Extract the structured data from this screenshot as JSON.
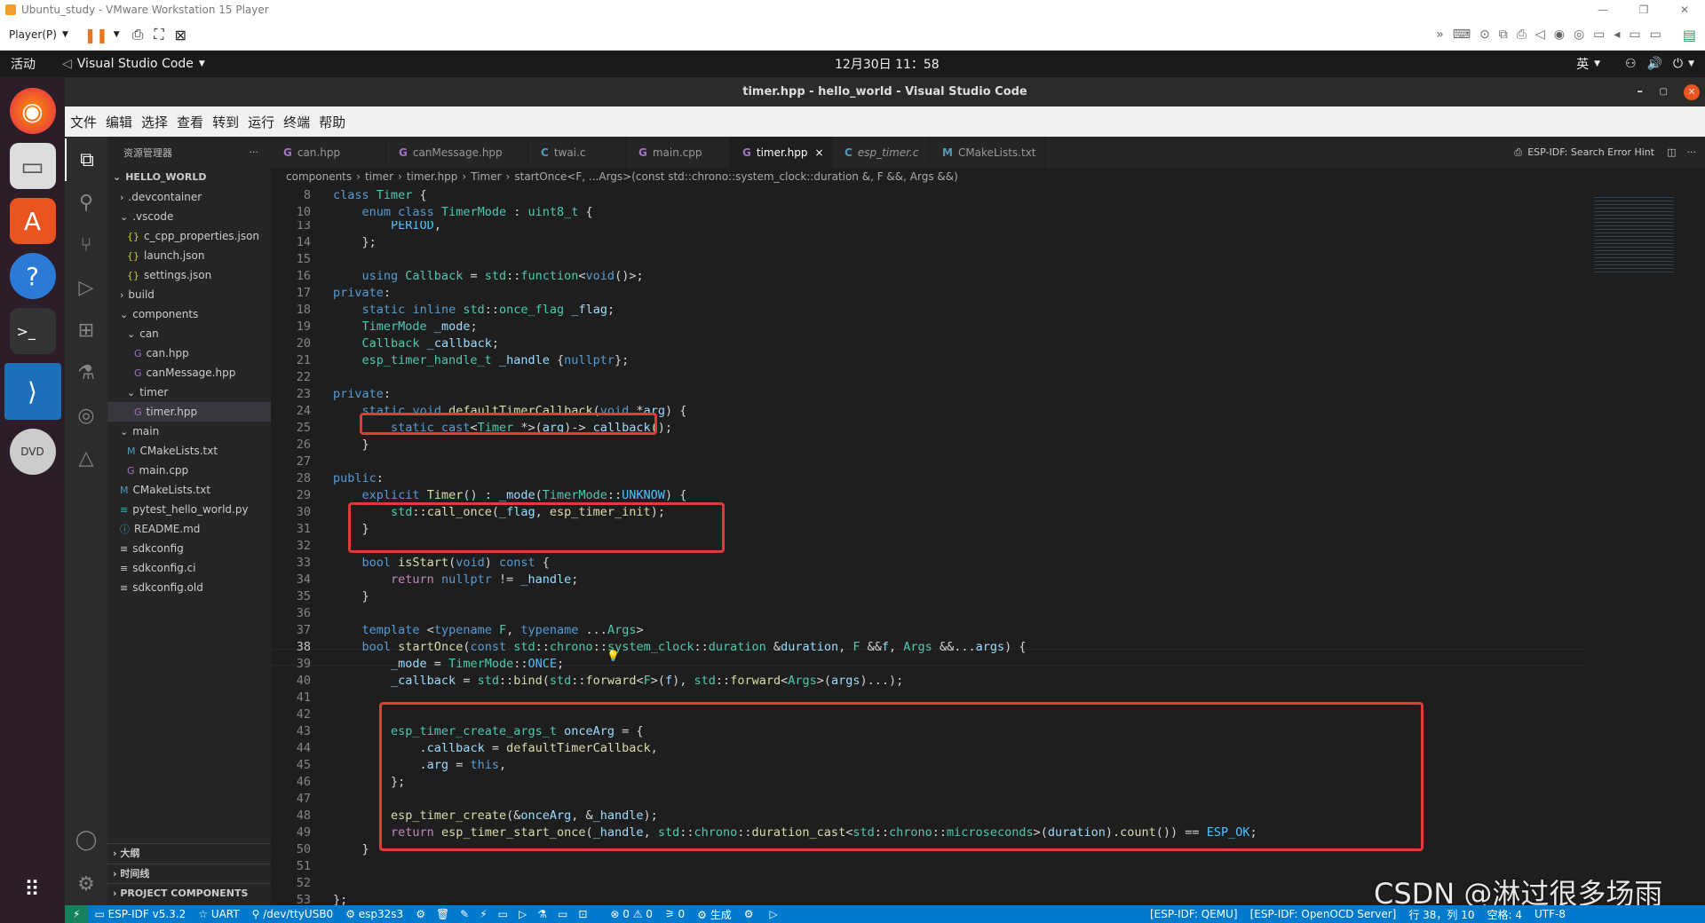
{
  "vm": {
    "title": "Ubuntu_study - VMware Workstation 15 Player",
    "player_menu": "Player(P)",
    "window_controls": [
      "minimize-icon",
      "restore-icon",
      "close-icon"
    ]
  },
  "gnome": {
    "activities": "活动",
    "app_name": "Visual Studio Code",
    "clock": "12月30日  11：58",
    "input_method": "英"
  },
  "vscode": {
    "window_title": "timer.hpp - hello_world - Visual Studio Code",
    "menu": [
      "文件",
      "编辑",
      "选择",
      "查看",
      "转到",
      "运行",
      "终端",
      "帮助"
    ],
    "explorer_title": "资源管理器",
    "explorer_more": "···",
    "tree": [
      {
        "label": "HELLO_WORLD",
        "depth": 0,
        "kind": "root"
      },
      {
        "label": ".devcontainer",
        "depth": 1,
        "kind": "folder-closed"
      },
      {
        "label": ".vscode",
        "depth": 1,
        "kind": "folder-open"
      },
      {
        "label": "c_cpp_properties.json",
        "depth": 2,
        "kind": "json"
      },
      {
        "label": "launch.json",
        "depth": 2,
        "kind": "json"
      },
      {
        "label": "settings.json",
        "depth": 2,
        "kind": "json"
      },
      {
        "label": "build",
        "depth": 1,
        "kind": "folder-closed"
      },
      {
        "label": "components",
        "depth": 1,
        "kind": "folder-open"
      },
      {
        "label": "can",
        "depth": 2,
        "kind": "folder-open"
      },
      {
        "label": "can.hpp",
        "depth": 3,
        "kind": "cpp"
      },
      {
        "label": "canMessage.hpp",
        "depth": 3,
        "kind": "cpp"
      },
      {
        "label": "timer",
        "depth": 2,
        "kind": "folder-open"
      },
      {
        "label": "timer.hpp",
        "depth": 3,
        "kind": "cpp",
        "selected": true
      },
      {
        "label": "main",
        "depth": 1,
        "kind": "folder-open"
      },
      {
        "label": "CMakeLists.txt",
        "depth": 2,
        "kind": "cmake"
      },
      {
        "label": "main.cpp",
        "depth": 2,
        "kind": "cpp"
      },
      {
        "label": "CMakeLists.txt",
        "depth": 1,
        "kind": "cmake"
      },
      {
        "label": "pytest_hello_world.py",
        "depth": 1,
        "kind": "py"
      },
      {
        "label": "README.md",
        "depth": 1,
        "kind": "md"
      },
      {
        "label": "sdkconfig",
        "depth": 1,
        "kind": "txt"
      },
      {
        "label": "sdkconfig.ci",
        "depth": 1,
        "kind": "txt"
      },
      {
        "label": "sdkconfig.old",
        "depth": 1,
        "kind": "txt"
      }
    ],
    "bottom_panels": [
      "大纲",
      "时间线",
      "PROJECT COMPONENTS"
    ],
    "tabs": [
      {
        "label": "can.hpp",
        "icon": "G"
      },
      {
        "label": "canMessage.hpp",
        "icon": "G"
      },
      {
        "label": "twai.c",
        "icon": "C"
      },
      {
        "label": "main.cpp",
        "icon": "G"
      },
      {
        "label": "timer.hpp",
        "icon": "G",
        "active": true,
        "close": "×"
      },
      {
        "label": "esp_timer.c",
        "icon": "C",
        "italic": true
      },
      {
        "label": "CMakeLists.txt",
        "icon": "M"
      }
    ],
    "tab_right": "ESP-IDF: Search Error Hint",
    "breadcrumb": [
      "components",
      "timer",
      "timer.hpp",
      "Timer",
      "startOnce<F, ...Args>(const std::chrono::system_clock::duration &, F &&, Args &&)"
    ],
    "code_lines": [
      {
        "n": "8",
        "html": "<span class='k'>class</span> <span class='t'>Timer</span> {"
      },
      {
        "n": "10",
        "html": "    <span class='k'>enum class</span> <span class='t'>TimerMode</span> : <span class='t'>uint8_t</span> {"
      },
      {
        "n": "13",
        "html": "        <span class='e'>PERIOD</span>,"
      },
      {
        "n": "14",
        "html": "    };"
      },
      {
        "n": "15",
        "html": ""
      },
      {
        "n": "16",
        "html": "    <span class='k'>using</span> <span class='t'>Callback</span> = <span class='t'>std</span>::<span class='t'>function</span>&lt;<span class='k'>void</span>()&gt;;"
      },
      {
        "n": "17",
        "html": "<span class='k'>private</span>:"
      },
      {
        "n": "18",
        "html": "    <span class='k'>static</span> <span class='k'>inline</span> <span class='t'>std</span>::<span class='t'>once_flag</span> <span class='v'>_flag</span>;"
      },
      {
        "n": "19",
        "html": "    <span class='t'>TimerMode</span> <span class='v'>_mode</span>;"
      },
      {
        "n": "20",
        "html": "    <span class='t'>Callback</span> <span class='v'>_callback</span>;"
      },
      {
        "n": "21",
        "html": "    <span class='t'>esp_timer_handle_t</span> <span class='v'>_handle</span> {<span class='k'>nullptr</span>};"
      },
      {
        "n": "22",
        "html": ""
      },
      {
        "n": "23",
        "html": "<span class='k'>private</span>:"
      },
      {
        "n": "24",
        "html": "    <span class='k'>static</span> <span class='k'>void</span> <span class='f'>defaultTimerCallback</span>(<span class='k'>void</span> *<span class='v'>arg</span>) {"
      },
      {
        "n": "25",
        "html": "        <span class='k'>static_cast</span>&lt;<span class='t'>Timer</span> *&gt;(<span class='v'>arg</span>)-&gt;<span class='v'>_callback</span>();"
      },
      {
        "n": "26",
        "html": "    }"
      },
      {
        "n": "27",
        "html": ""
      },
      {
        "n": "28",
        "html": "<span class='k'>public</span>:"
      },
      {
        "n": "29",
        "html": "    <span class='k'>explicit</span> <span class='f'>Timer</span>() : <span class='v'>_mode</span>(<span class='t'>TimerMode</span>::<span class='e'>UNKNOW</span>) {"
      },
      {
        "n": "30",
        "html": "        <span class='t'>std</span>::<span class='f'>call_once</span>(<span class='v'>_flag</span>, <span class='f'>esp_timer_init</span>);"
      },
      {
        "n": "31",
        "html": "    }"
      },
      {
        "n": "32",
        "html": ""
      },
      {
        "n": "33",
        "html": "    <span class='k'>bool</span> <span class='f'>isStart</span>(<span class='k'>void</span>) <span class='k'>const</span> {"
      },
      {
        "n": "34",
        "html": "        <span class='p'>return</span> <span class='k'>nullptr</span> != <span class='v'>_handle</span>;"
      },
      {
        "n": "35",
        "html": "    }"
      },
      {
        "n": "36",
        "html": ""
      },
      {
        "n": "37",
        "html": "    <span class='k'>template</span> &lt;<span class='k'>typename</span> <span class='t'>F</span>, <span class='k'>typename</span> ...<span class='t'>Args</span>&gt;"
      },
      {
        "n": "38",
        "html": "    <span class='k'>bool</span> <span class='f'>startOnce</span>(<span class='k'>const</span> <span class='t'>std</span>::<span class='t'>chrono</span>::<span class='t'>system_clock</span>::<span class='t'>duration</span> &amp;<span class='v'>duration</span>, <span class='t'>F</span> &amp;&amp;<span class='v'>f</span>, <span class='t'>Args</span> &amp;&amp;...<span class='v'>args</span>) {"
      },
      {
        "n": "39",
        "html": "        <span class='v'>_mode</span> = <span class='t'>TimerMode</span>::<span class='e'>ONCE</span>;"
      },
      {
        "n": "40",
        "html": "        <span class='v'>_callback</span> = <span class='t'>std</span>::<span class='f'>bind</span>(<span class='t'>std</span>::<span class='f'>forward</span>&lt;<span class='t'>F</span>&gt;(<span class='v'>f</span>), <span class='t'>std</span>::<span class='f'>forward</span>&lt;<span class='t'>Args</span>&gt;(<span class='v'>args</span>)...);"
      },
      {
        "n": "41",
        "html": ""
      },
      {
        "n": "42",
        "html": ""
      },
      {
        "n": "43",
        "html": "        <span class='t'>esp_timer_create_args_t</span> <span class='v'>onceArg</span> = {"
      },
      {
        "n": "44",
        "html": "            .<span class='v'>callback</span> = <span class='f'>defaultTimerCallback</span>,"
      },
      {
        "n": "45",
        "html": "            .<span class='v'>arg</span> = <span class='k'>this</span>,"
      },
      {
        "n": "46",
        "html": "        };"
      },
      {
        "n": "47",
        "html": ""
      },
      {
        "n": "48",
        "html": "        <span class='f'>esp_timer_create</span>(&amp;<span class='v'>onceArg</span>, &amp;<span class='v'>_handle</span>);"
      },
      {
        "n": "49",
        "html": "        <span class='p'>return</span> <span class='f'>esp_timer_start_once</span>(<span class='v'>_handle</span>, <span class='t'>std</span>::<span class='t'>chrono</span>::<span class='f'>duration_cast</span>&lt;<span class='t'>std</span>::<span class='t'>chrono</span>::<span class='t'>microseconds</span>&gt;(<span class='v'>duration</span>).<span class='f'>count</span>()) == <span class='e'>ESP_OK</span>;"
      },
      {
        "n": "50",
        "html": "    }"
      },
      {
        "n": "51",
        "html": ""
      },
      {
        "n": "52",
        "html": ""
      },
      {
        "n": "53",
        "html": "};"
      }
    ],
    "statusbar": {
      "remote": "⚡",
      "idf": "ESP-IDF v5.3.2",
      "uart": "UART",
      "port": "/dev/ttyUSB0",
      "target": "esp32s3",
      "problems": "⊗ 0 ⚠ 0",
      "ports": "0",
      "build": "生成",
      "qemu": "[ESP-IDF: QEMU]",
      "openocd": "[ESP-IDF: OpenOCD Server]",
      "position": "行 38，列 10",
      "spaces": "空格: 4",
      "encoding": "UTF-8"
    },
    "watermark": "CSDN @淋过很多场雨"
  }
}
